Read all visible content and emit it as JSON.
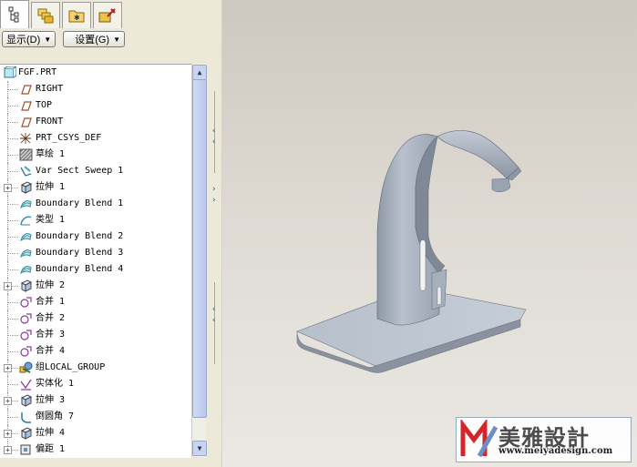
{
  "toolbar": {
    "display_label": "显示(D)",
    "settings_label": "设置(G)"
  },
  "tabs": [
    "model-tree-icon",
    "layers-icon",
    "folder-icon",
    "tools-icon"
  ],
  "tree": {
    "root": "FGF.PRT",
    "items": [
      {
        "label": "RIGHT",
        "icon": "datum-plane-icon",
        "expandable": false
      },
      {
        "label": "TOP",
        "icon": "datum-plane-icon",
        "expandable": false
      },
      {
        "label": "FRONT",
        "icon": "datum-plane-icon",
        "expandable": false
      },
      {
        "label": "PRT_CSYS_DEF",
        "icon": "csys-icon",
        "expandable": false
      },
      {
        "label": "草绘 1",
        "icon": "sketch-icon",
        "expandable": false
      },
      {
        "label": "Var Sect Sweep 1",
        "icon": "sweep-icon",
        "expandable": false
      },
      {
        "label": "拉伸 1",
        "icon": "extrude-icon",
        "expandable": true
      },
      {
        "label": "Boundary Blend 1",
        "icon": "boundary-blend-icon",
        "expandable": false
      },
      {
        "label": "类型 1",
        "icon": "surface-icon",
        "expandable": false
      },
      {
        "label": "Boundary Blend 2",
        "icon": "boundary-blend-icon",
        "expandable": false
      },
      {
        "label": "Boundary Blend 3",
        "icon": "boundary-blend-icon",
        "expandable": false
      },
      {
        "label": "Boundary Blend 4",
        "icon": "boundary-blend-icon",
        "expandable": false
      },
      {
        "label": "拉伸 2",
        "icon": "extrude-icon",
        "expandable": true
      },
      {
        "label": "合并 1",
        "icon": "merge-icon",
        "expandable": false
      },
      {
        "label": "合并 2",
        "icon": "merge-icon",
        "expandable": false
      },
      {
        "label": "合并 3",
        "icon": "merge-icon",
        "expandable": false
      },
      {
        "label": "合并 4",
        "icon": "merge-icon",
        "expandable": false
      },
      {
        "label": "组LOCAL_GROUP",
        "icon": "group-icon",
        "expandable": true
      },
      {
        "label": "实体化 1",
        "icon": "solidify-icon",
        "expandable": false
      },
      {
        "label": "拉伸 3",
        "icon": "extrude-icon",
        "expandable": true
      },
      {
        "label": "倒圆角 7",
        "icon": "round-icon",
        "expandable": false
      },
      {
        "label": "拉伸 4",
        "icon": "extrude-icon",
        "expandable": true
      },
      {
        "label": "偏距 1",
        "icon": "offset-icon",
        "expandable": true
      }
    ]
  },
  "watermark": {
    "brand": "美雅設計",
    "url": "www.meiyadesign.com"
  },
  "colors": {
    "panel": "#ece9d8",
    "model": "#a9b3c2",
    "background": "#d9d5cf"
  }
}
